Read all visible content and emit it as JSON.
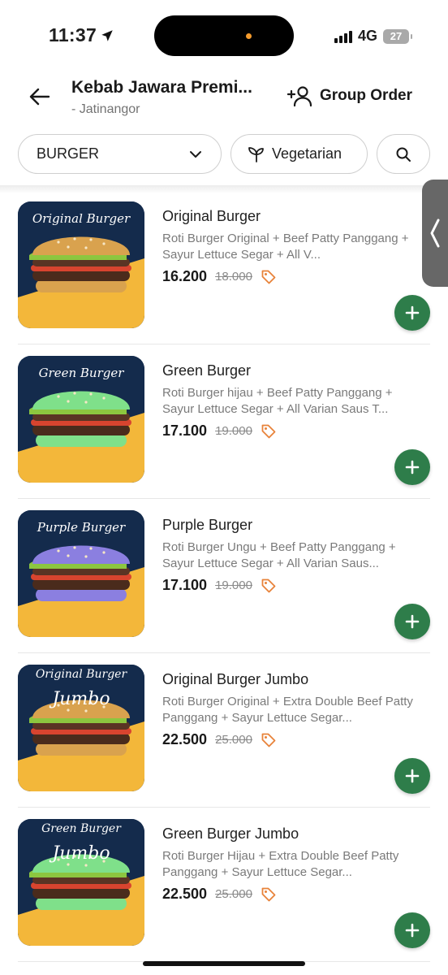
{
  "status_bar": {
    "time": "11:37",
    "network": "4G",
    "battery": "27"
  },
  "header": {
    "store_name": "Kebab Jawara Premi...",
    "store_branch": "- Jatinangor",
    "group_order_label": "Group Order"
  },
  "filters": {
    "category_value": "BURGER",
    "vegetarian_label": "Vegetarian"
  },
  "colors": {
    "accent_green": "#2e7d4a",
    "discount_tag": "#e8833a",
    "thumb_bg": "#142b4c",
    "thumb_yellow": "#f3b73a"
  },
  "menu_items": [
    {
      "thumb_line1": "Original Burger",
      "thumb_line2": "",
      "name": "Original Burger",
      "description": "Roti Burger Original + Beef Patty Panggang + Sayur Lettuce Segar + All V...",
      "price": "16.200",
      "original_price": "18.000",
      "bun_color": "#d9a24e"
    },
    {
      "thumb_line1": "Green Burger",
      "thumb_line2": "",
      "name": "Green Burger",
      "description": "Roti Burger hijau + Beef Patty Panggang + Sayur Lettuce Segar + All Varian Saus T...",
      "price": "17.100",
      "original_price": "19.000",
      "bun_color": "#7fe08a"
    },
    {
      "thumb_line1": "Purple Burger",
      "thumb_line2": "",
      "name": "Purple Burger",
      "description": "Roti Burger Ungu + Beef Patty Panggang + Sayur Lettuce Segar + All Varian Saus...",
      "price": "17.100",
      "original_price": "19.000",
      "bun_color": "#8b7fe0"
    },
    {
      "thumb_line1": "Original Burger",
      "thumb_line2": "Jumbo",
      "name": "Original Burger Jumbo",
      "description": "Roti Burger Original + Extra Double Beef Patty Panggang + Sayur Lettuce Segar...",
      "price": "22.500",
      "original_price": "25.000",
      "bun_color": "#d9a24e"
    },
    {
      "thumb_line1": "Green Burger",
      "thumb_line2": "Jumbo",
      "name": "Green Burger Jumbo",
      "description": "Roti Burger Hijau + Extra Double Beef Patty Panggang + Sayur Lettuce Segar...",
      "price": "22.500",
      "original_price": "25.000",
      "bun_color": "#7fe08a"
    }
  ]
}
